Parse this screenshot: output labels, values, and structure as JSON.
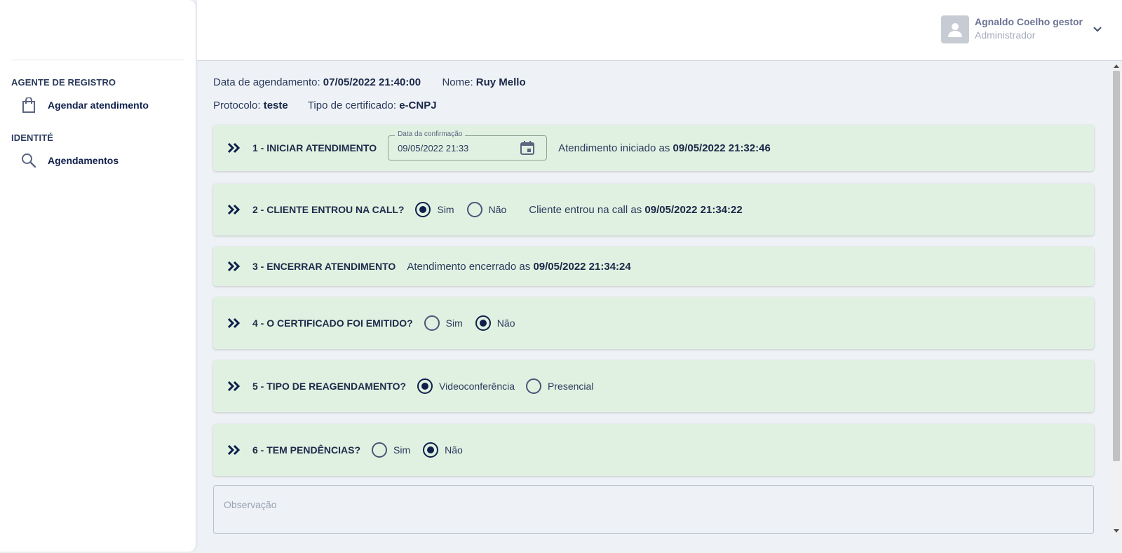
{
  "sidebar": {
    "sections": [
      {
        "title": "AGENTE DE REGISTRO",
        "items": [
          {
            "label": "Agendar atendimento",
            "icon": "shopping-bag-icon"
          }
        ]
      },
      {
        "title": "IDENTITÉ",
        "items": [
          {
            "label": "Agendamentos",
            "icon": "search-icon"
          }
        ]
      }
    ]
  },
  "header": {
    "user_name": "Agnaldo Coelho gestor",
    "user_role": "Administrador"
  },
  "info": {
    "date_label": "Data de agendamento:",
    "date_value": "07/05/2022 21:40:00",
    "name_label": "Nome:",
    "name_value": "Ruy Mello",
    "protocol_label": "Protocolo:",
    "protocol_value": "teste",
    "cert_label": "Tipo de certificado:",
    "cert_value": "e-CNPJ"
  },
  "steps": [
    {
      "title": "1 - INICIAR ATENDIMENTO",
      "field_label": "Data da confirmação",
      "field_value": "09/05/2022 21:33",
      "status_text": "Atendimento iniciado as",
      "status_value": "09/05/2022 21:32:46"
    },
    {
      "title": "2 - CLIENTE ENTROU NA CALL?",
      "options": [
        {
          "label": "Sim",
          "checked": true
        },
        {
          "label": "Não",
          "checked": false
        }
      ],
      "status_text": "Cliente entrou na call as",
      "status_value": "09/05/2022 21:34:22"
    },
    {
      "title": "3 - ENCERRAR ATENDIMENTO",
      "status_text": "Atendimento encerrado as",
      "status_value": "09/05/2022 21:34:24"
    },
    {
      "title": "4 - O CERTIFICADO FOI EMITIDO?",
      "options": [
        {
          "label": "Sim",
          "checked": false
        },
        {
          "label": "Não",
          "checked": true
        }
      ]
    },
    {
      "title": "5 - TIPO DE REAGENDAMENTO?",
      "options": [
        {
          "label": "Videoconferência",
          "checked": true
        },
        {
          "label": "Presencial",
          "checked": false
        }
      ]
    },
    {
      "title": "6 - TEM PENDÊNCIAS?",
      "options": [
        {
          "label": "Sim",
          "checked": false
        },
        {
          "label": "Não",
          "checked": true
        }
      ]
    }
  ],
  "observacao": {
    "placeholder": "Observação"
  },
  "colors": {
    "step_bg": "#e0f1e1",
    "accent": "#0f1f4b",
    "page_bg": "#eef2f6"
  }
}
